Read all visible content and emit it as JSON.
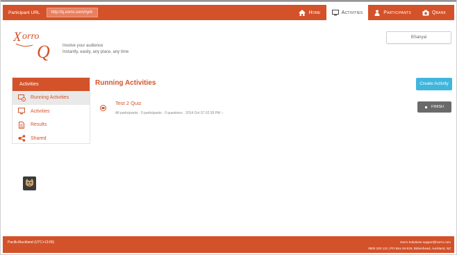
{
  "topbar": {
    "participant_url_label": "Participant URL",
    "participant_url_value": "http://q.xorro.com/nyrk"
  },
  "nav": {
    "items": [
      {
        "label": "Home",
        "icon": "home-icon"
      },
      {
        "label": "Activities",
        "icon": "monitor-icon"
      },
      {
        "label": "Participants",
        "icon": "person-icon"
      },
      {
        "label": "Qbank",
        "icon": "camera-icon"
      }
    ],
    "active": "Activities"
  },
  "brand": {
    "tagline_1": "Involve your audience",
    "tagline_2": "Instantly, easily, any place, any time"
  },
  "user": {
    "name": "BSanyal"
  },
  "sidebar": {
    "heading": "Activities",
    "items": [
      {
        "label": "Running Activities",
        "icon": "running-activities-icon",
        "active": true
      },
      {
        "label": "Activities",
        "icon": "monitor-icon",
        "active": false
      },
      {
        "label": "Results",
        "icon": "document-icon",
        "active": false
      },
      {
        "label": "Shared",
        "icon": "share-icon",
        "active": false
      }
    ]
  },
  "main": {
    "title": "Running Activities",
    "activity": {
      "title": "Test 2 Quiz",
      "meta": "All participants · 0 participants · 0 questions · 2014 Oct 07 02:39 PM –"
    },
    "create_button": "Create Activity",
    "finish_button": "FINISH"
  },
  "footer": {
    "left": "Pacific/Auckland (UTC+13:00)",
    "right_1": "Xorro Solutions support@xorro.com",
    "right_2": "0800 220 121 | PO Box 34-619, Birkenhead, Auckland, NZ"
  },
  "colors": {
    "brand": "#d35229",
    "accent": "#3fb6dd",
    "finish": "#6a6a6a"
  }
}
